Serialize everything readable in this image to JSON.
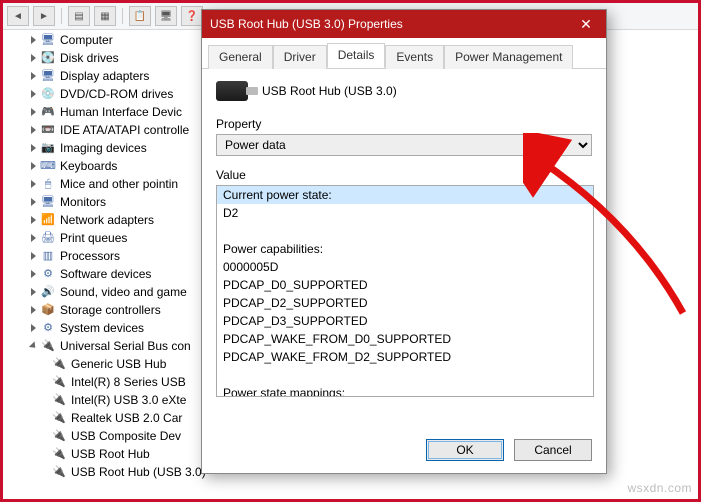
{
  "window": {
    "title": "USB Root Hub (USB 3.0) Properties",
    "tabs": [
      "General",
      "Driver",
      "Details",
      "Events",
      "Power Management"
    ],
    "active_tab": 2,
    "device_name": "USB Root Hub (USB 3.0)",
    "property_label": "Property",
    "property_value": "Power data",
    "value_label": "Value",
    "value_lines": [
      "Current power state:",
      "D2",
      "",
      "Power capabilities:",
      "0000005D",
      "PDCAP_D0_SUPPORTED",
      "PDCAP_D2_SUPPORTED",
      "PDCAP_D3_SUPPORTED",
      "PDCAP_WAKE_FROM_D0_SUPPORTED",
      "PDCAP_WAKE_FROM_D2_SUPPORTED",
      "",
      "Power state mappings:"
    ],
    "ok": "OK",
    "cancel": "Cancel"
  },
  "tree": {
    "items": [
      "Computer",
      "Disk drives",
      "Display adapters",
      "DVD/CD-ROM drives",
      "Human Interface Devic",
      "IDE ATA/ATAPI controlle",
      "Imaging devices",
      "Keyboards",
      "Mice and other pointin",
      "Monitors",
      "Network adapters",
      "Print queues",
      "Processors",
      "Software devices",
      "Sound, video and game",
      "Storage controllers",
      "System devices"
    ],
    "usb_label": "Universal Serial Bus con",
    "usb_children": [
      "Generic USB Hub",
      "Intel(R) 8 Series USB",
      "Intel(R) USB 3.0 eXte",
      "Realtek USB 2.0 Car",
      "USB Composite Dev",
      "USB Root Hub",
      "USB Root Hub (USB 3.0)"
    ]
  },
  "watermark": "wsxdn.com"
}
